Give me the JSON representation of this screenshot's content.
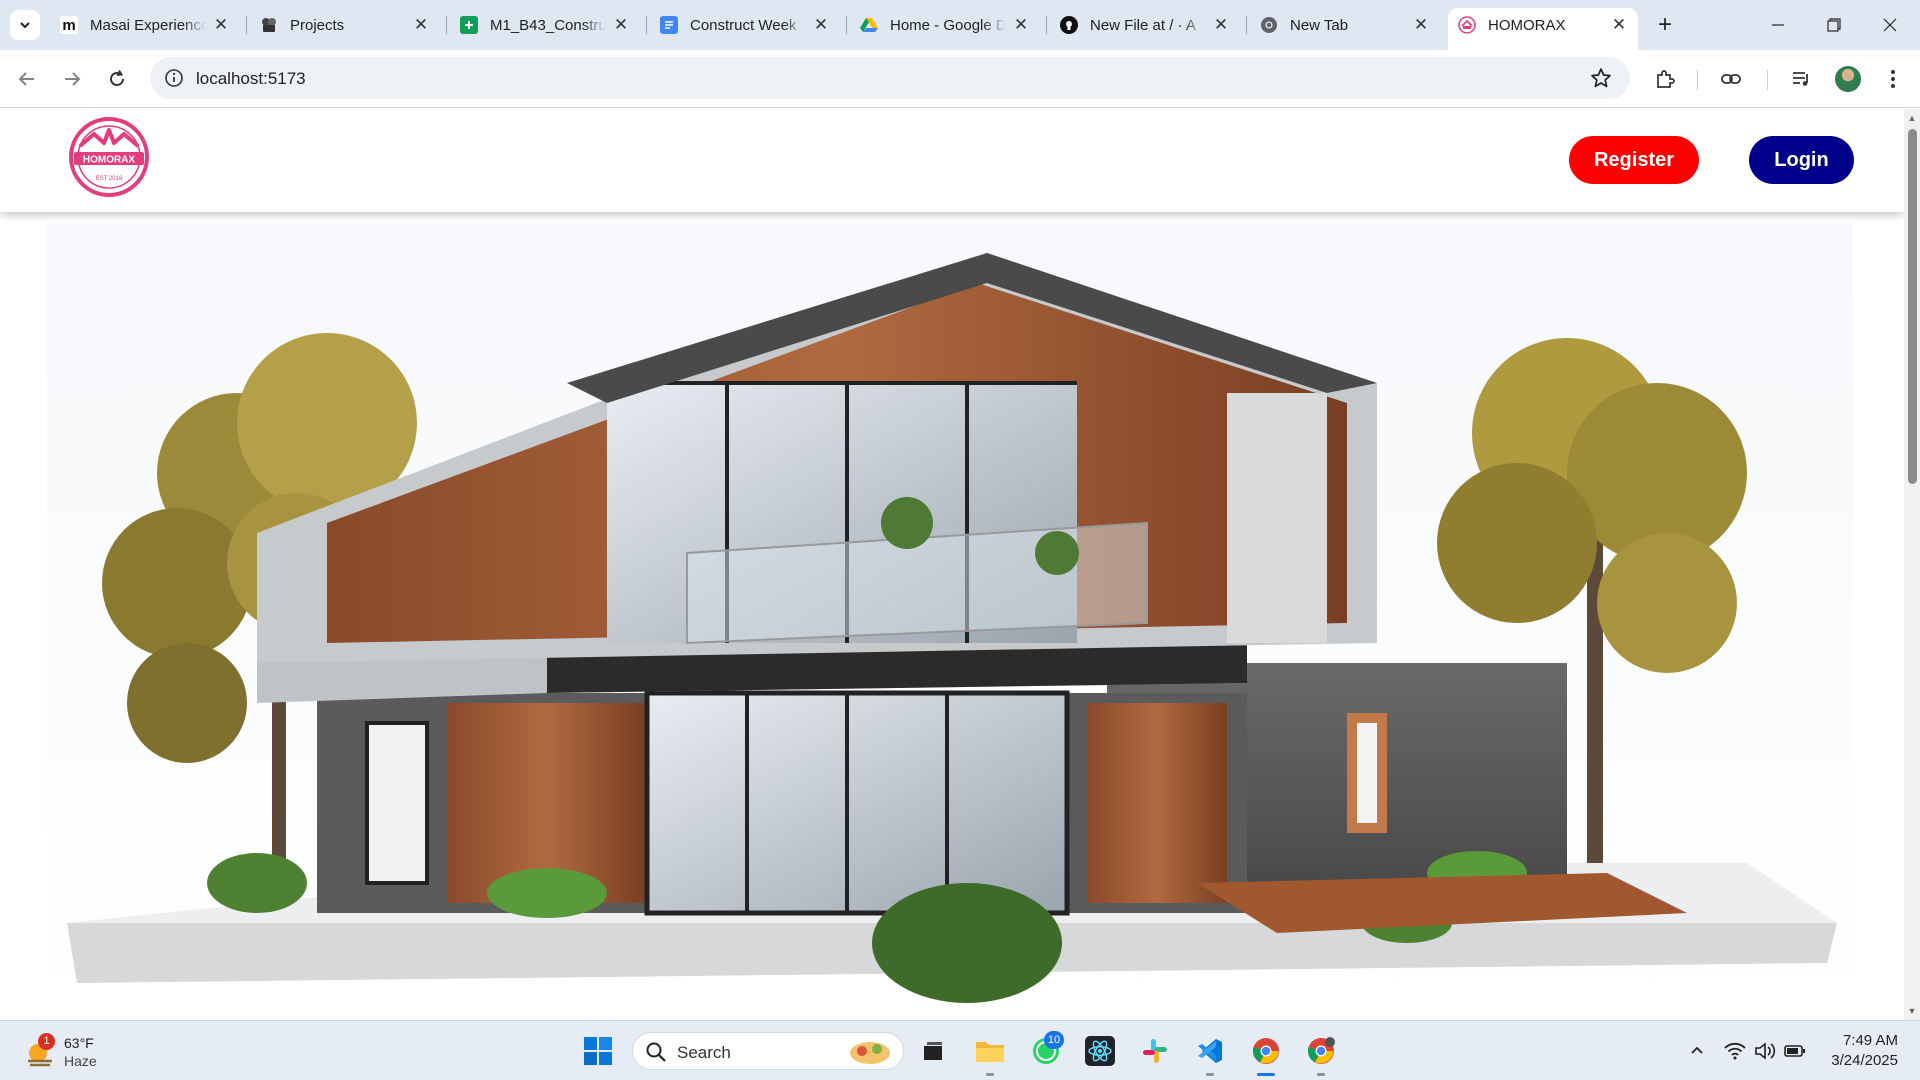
{
  "browser": {
    "tabs": [
      {
        "title": "Masai Experience",
        "favicon": "masai-m-icon"
      },
      {
        "title": "Projects",
        "favicon": "projects-icon"
      },
      {
        "title": "M1_B43_Constru",
        "favicon": "google-sheets-icon"
      },
      {
        "title": "Construct Week",
        "favicon": "google-docs-icon"
      },
      {
        "title": "Home - Google D",
        "favicon": "google-drive-icon"
      },
      {
        "title": "New File at / · A",
        "favicon": "github-icon"
      },
      {
        "title": "New Tab",
        "favicon": "chrome-icon"
      },
      {
        "title": "HOMORAX",
        "favicon": "homorax-favicon"
      }
    ],
    "active_tab": 7,
    "url": "localhost:5173"
  },
  "site": {
    "logo_text": "HOMORAX",
    "logo_est": "EST 2016",
    "register_label": "Register",
    "login_label": "Login",
    "accent_red": "#ff0000",
    "accent_navy": "#00008b",
    "hero_image": "modern-house-illustration"
  },
  "taskbar": {
    "weather": {
      "temp": "63°F",
      "condition": "Haze",
      "badge": "1"
    },
    "search_label": "Search",
    "whatsapp_badge": "10",
    "apps": [
      "start-icon",
      "file-explorer-icon",
      "whatsapp-icon",
      "react-icon",
      "slack-icon",
      "vscode-icon",
      "chrome-icon",
      "chrome-profile-icon"
    ],
    "time": "7:49 AM",
    "date": "3/24/2025"
  }
}
